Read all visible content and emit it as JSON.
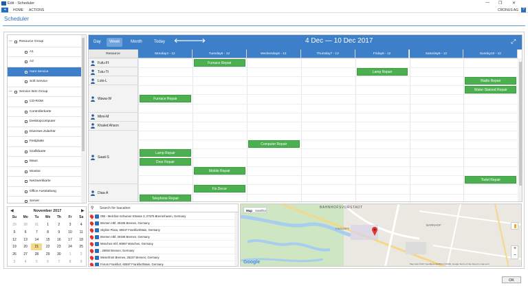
{
  "window": {
    "title": "Edit - Scheduler",
    "minimize": "—",
    "restore": "❐",
    "close": "✕"
  },
  "menu": {
    "file_icon": "◂",
    "home": "HOME",
    "actions": "ACTIONS",
    "company": "CRONUS AG",
    "help": "?"
  },
  "page": {
    "title": "Scheduler"
  },
  "tree": {
    "items": [
      {
        "label": "Resource Group",
        "level": 0,
        "expander": "—"
      },
      {
        "label": "A1",
        "level": 1
      },
      {
        "label": "A2",
        "level": 1
      },
      {
        "label": "Hant Service",
        "level": 1,
        "selected": true
      },
      {
        "label": "Soft Service",
        "level": 1
      },
      {
        "label": "Service Item Group",
        "level": 0,
        "expander": "—"
      },
      {
        "label": "CD-ROM",
        "level": 1
      },
      {
        "label": "Controllerkarte",
        "level": 1
      },
      {
        "label": "Desktopcomputer",
        "level": 1
      },
      {
        "label": "Diverses Zubehör",
        "level": 1
      },
      {
        "label": "Festplatte",
        "level": 1
      },
      {
        "label": "Grafikkarte",
        "level": 1
      },
      {
        "label": "Maus",
        "level": 1
      },
      {
        "label": "Monitor",
        "level": 1
      },
      {
        "label": "Netzwerkkarte",
        "level": 1
      },
      {
        "label": "Office Ausstattung",
        "level": 1
      },
      {
        "label": "Server",
        "level": 1
      }
    ]
  },
  "calendar": {
    "month": "November 2017",
    "prev": "◀",
    "next": "▶",
    "weekdays": [
      "Su",
      "Mo",
      "Tu",
      "We",
      "Th",
      "Fr",
      "Sa"
    ],
    "weeks": [
      [
        "29",
        "30",
        "31",
        "1",
        "2",
        "3",
        "4"
      ],
      [
        "5",
        "6",
        "7",
        "8",
        "9",
        "10",
        "11"
      ],
      [
        "12",
        "13",
        "14",
        "15",
        "16",
        "17",
        "18"
      ],
      [
        "19",
        "20",
        "21",
        "22",
        "23",
        "24",
        "25"
      ],
      [
        "26",
        "27",
        "28",
        "29",
        "30",
        "1",
        "2"
      ],
      [
        "3",
        "4",
        "5",
        "6",
        "7",
        "8",
        "9"
      ]
    ],
    "today": "21"
  },
  "scheduler": {
    "views": [
      "Day",
      "Week",
      "Month",
      "Today"
    ],
    "active_view": "Week",
    "prev_arrow": "🡐",
    "next_arrow": "🡒",
    "range": "4 Dec — 10 Dec 2017",
    "fullscreen_icon": "⤢",
    "resource_header": "Resource",
    "days": [
      "Monday4 - 12",
      "Tuesday5 - 12",
      "Wednesday6 - 12",
      "Thursday7 - 12",
      "Friday8 - 12",
      "Saturday9 - 12",
      "Sunday10 - 12"
    ],
    "resources": [
      "Fufu-Ff",
      "Tutu-Tt",
      "Lolo-L",
      "Wawa-W",
      "Mimi-M",
      "Khaled Ahson",
      "Saad-S",
      "Diaa-A"
    ],
    "events": [
      {
        "label": "Furnace Repair",
        "day": 1,
        "row": 0
      },
      {
        "label": "Lamp Repair",
        "day": 4,
        "row": 1
      },
      {
        "label": "Radio Repair",
        "day": 6,
        "row": 2
      },
      {
        "label": "Water-Stained Repair",
        "day": 6,
        "row": 3
      },
      {
        "label": "Furnace Repair",
        "day": 0,
        "row": 4
      },
      {
        "label": "Computer Repair",
        "day": 2,
        "row": 9
      },
      {
        "label": "Lamp Repair",
        "day": 0,
        "row": 10
      },
      {
        "label": "Door Repair",
        "day": 0,
        "row": 11
      },
      {
        "label": "Mobile Repair",
        "day": 1,
        "row": 12
      },
      {
        "label": "Todet Repair",
        "day": 6,
        "row": 13
      },
      {
        "label": "Fix Decor",
        "day": 1,
        "row": 14
      },
      {
        "label": "Telephone Repair",
        "day": 0,
        "row": 15
      }
    ]
  },
  "location": {
    "search_icon": "⚲",
    "search_placeholder": "Search for loacation",
    "items": [
      "OBI - Melchior-Schwoon-Strasse 3, 27576 Bremerhaven, Germany",
      "Bremen Hbf, 28195 Bremen, Germany",
      "Skyline Plaza, 60547 Frankfurt/Main, Germany",
      "Bremen Hbf, 28195 Bremen, Germany",
      "München Hbf, 80997 München, Germany",
      ", 28092 Bremen, Germany",
      "Weserfront Bremen, 28237 Bremen, Germany",
      "Forum Frankfurt, 60597 Frankfurt/Main, Germany"
    ]
  },
  "map": {
    "tab_map": "Map",
    "tab_satellite": "Satellite",
    "district_1": "BAHNHOFSVORSTADT",
    "district_2": "FINDORFF",
    "district_3": "BARKHOF",
    "google": "Google",
    "attribution": "Map data ©2017 GeoBasis-DE/BKG (©2009), Google   Terms of Use   Report a map error",
    "zoom_in": "+",
    "zoom_out": "−"
  },
  "footer": {
    "ok": "OK"
  }
}
